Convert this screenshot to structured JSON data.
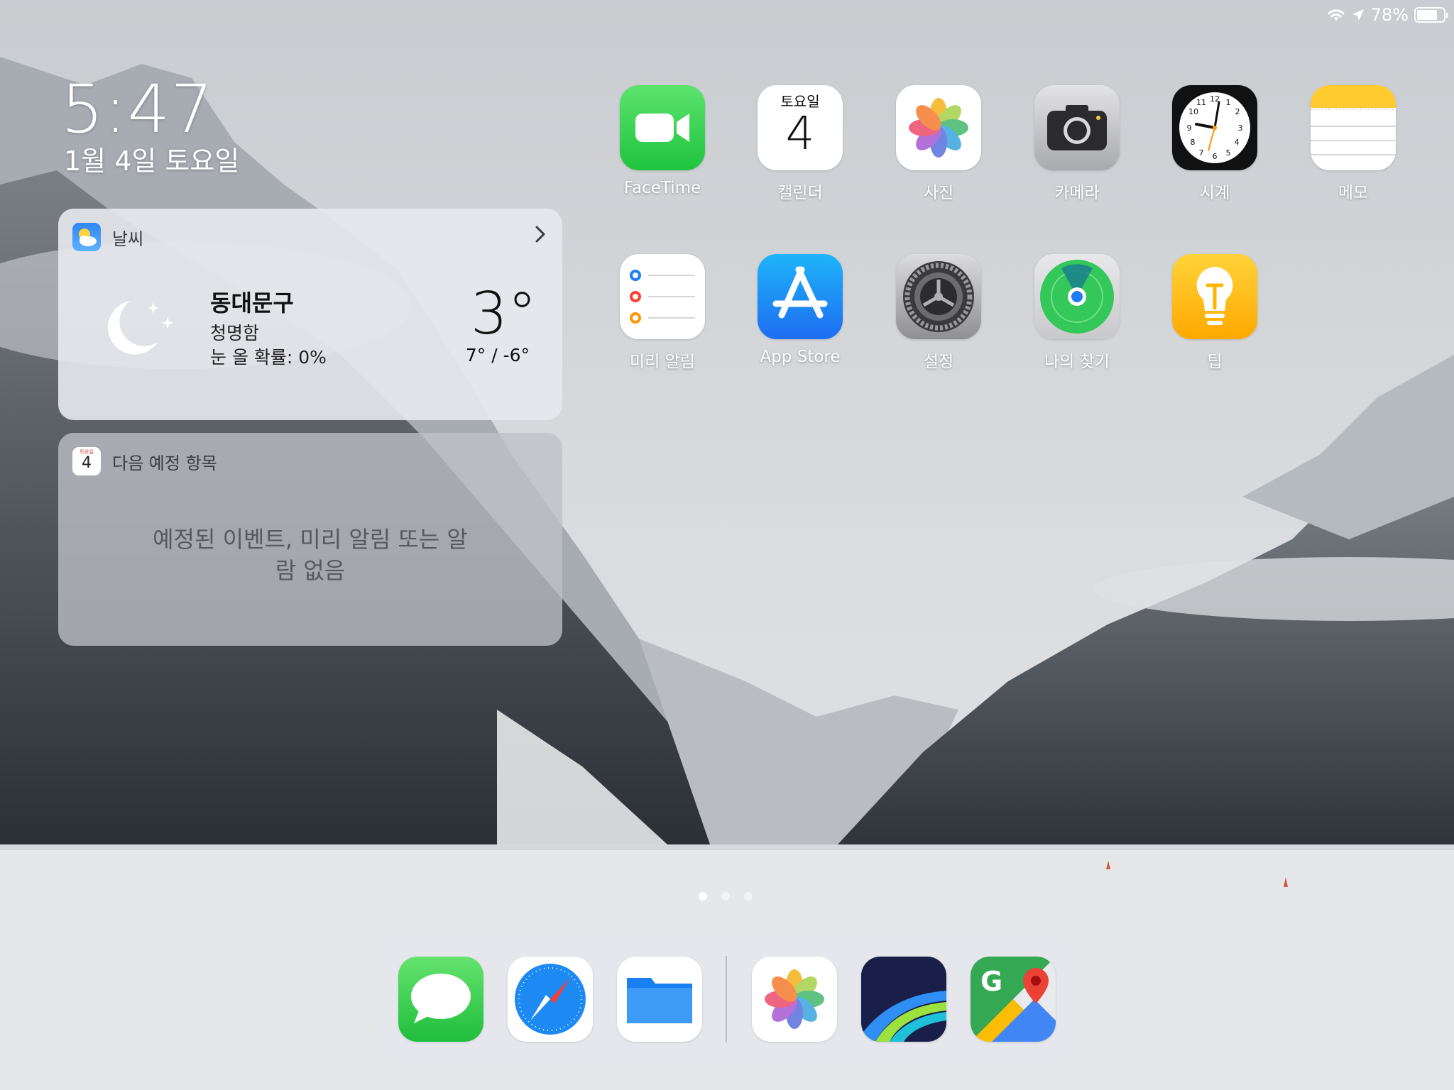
{
  "status_bar": {
    "battery_text": "78%",
    "battery_level": 0.78
  },
  "lock": {
    "time": "5:47",
    "date": "1월 4일 토요일"
  },
  "weather_widget": {
    "title": "날씨",
    "location": "동대문구",
    "condition": "청명함",
    "snow_chance": "눈 올 확률: 0%",
    "temperature": "3°",
    "range": "7° / -6°"
  },
  "upnext_widget": {
    "title": "다음 예정 항목",
    "icon_day": "4",
    "icon_weekday": "토요일",
    "empty_line1": "예정된 이벤트, 미리 알림 또는 알",
    "empty_line2": "람 없음"
  },
  "apps": {
    "facetime": "FaceTime",
    "calendar": "캘린더",
    "calendar_weekday": "토요일",
    "calendar_day": "4",
    "photos": "사진",
    "camera": "카메라",
    "clock": "시계",
    "notes": "메모",
    "reminders": "미리 알림",
    "appstore": "App Store",
    "settings": "설정",
    "findmy": "나의 찾기",
    "tips": "팁"
  },
  "page_indicator": {
    "count": 3,
    "current": 1
  },
  "dock": [
    "messages-icon",
    "safari-icon",
    "files-icon",
    "photos-icon",
    "lumafusion-icon",
    "google-maps-icon"
  ],
  "colors": {
    "facetime": "#2ad04b",
    "appstore": "#1a8cf5",
    "tips": "#ffc30a",
    "messages": "#34c759"
  }
}
